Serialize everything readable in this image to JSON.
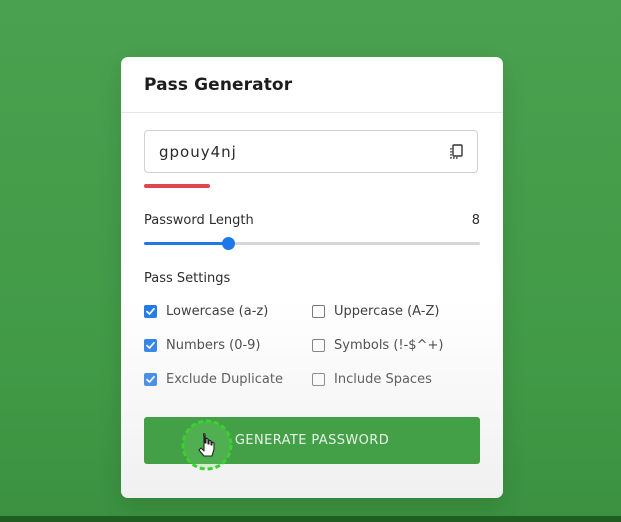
{
  "card": {
    "title": "Pass Generator"
  },
  "password": {
    "value": "gpouy4nj",
    "copy_icon": "copy-icon",
    "strength_color": "#e0474c"
  },
  "length": {
    "label": "Password Length",
    "value": "8",
    "slider_fraction": 0.25
  },
  "settings": {
    "label": "Pass Settings",
    "options": [
      {
        "label": "Lowercase (a-z)",
        "checked": true
      },
      {
        "label": "Uppercase (A-Z)",
        "checked": false
      },
      {
        "label": "Numbers (0-9)",
        "checked": true
      },
      {
        "label": "Symbols (!-$^+)",
        "checked": false
      },
      {
        "label": "Exclude Duplicate",
        "checked": true
      },
      {
        "label": "Include Spaces",
        "checked": false
      }
    ]
  },
  "button": {
    "label": "GENERATE PASSWORD"
  },
  "colors": {
    "background": "#43a047",
    "accent": "#1e78e8",
    "button": "#43a047"
  }
}
